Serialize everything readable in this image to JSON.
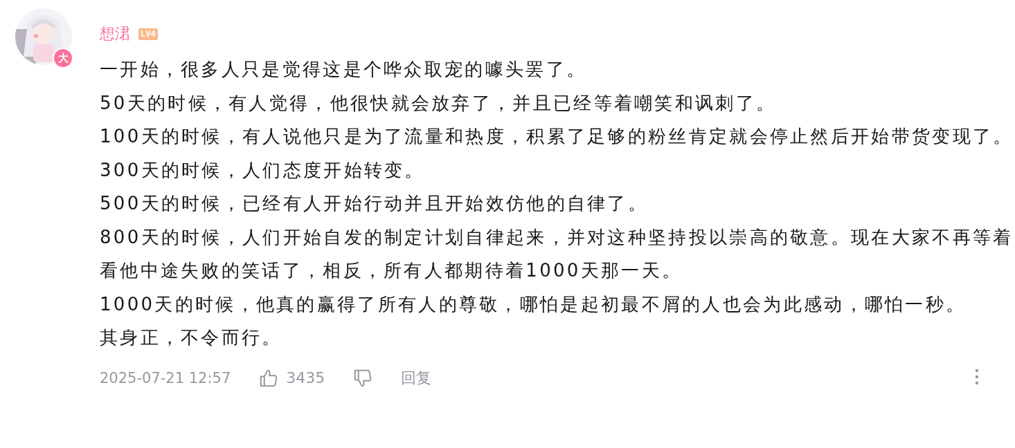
{
  "comment": {
    "author": {
      "name": "想涒",
      "level": "LV4",
      "badge": "大"
    },
    "paragraphs": [
      "一开始，很多人只是觉得这是个哗众取宠的噱头罢了。",
      "50天的时候，有人觉得，他很快就会放弃了，并且已经等着嘲笑和讽刺了。",
      "100天的时候，有人说他只是为了流量和热度，积累了足够的粉丝肯定就会停止然后开始带货变现了。",
      "300天的时候，人们态度开始转变。",
      "500天的时候，已经有人开始行动并且开始效仿他的自律了。",
      "800天的时候，人们开始自发的制定计划自律起来，并对这种坚持投以崇高的敬意。现在大家不再等着看他中途失败的笑话了，相反，所有人都期待着1000天那一天。",
      "1000天的时候，他真的赢得了所有人的尊敬，哪怕是起初最不屑的人也会为此感动，哪怕一秒。",
      "其身正，不令而行。"
    ],
    "time": "2025-07-21 12:57",
    "likes": "3435",
    "reply": "回复"
  }
}
